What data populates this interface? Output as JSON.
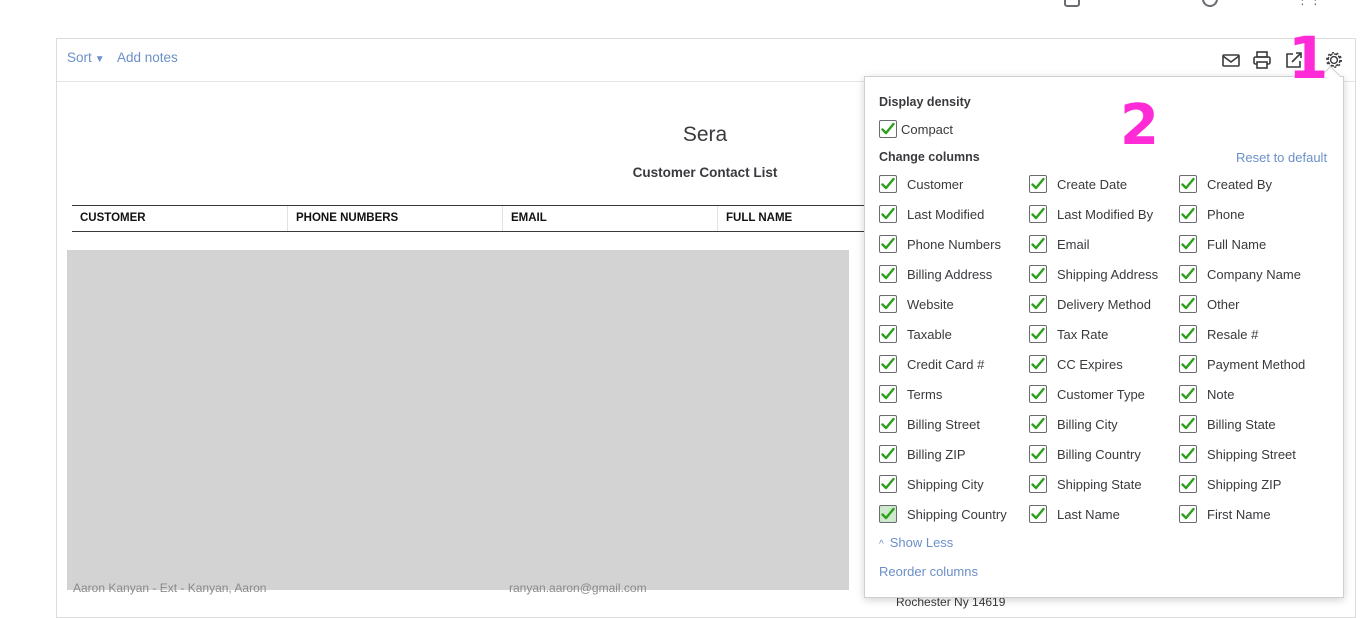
{
  "colors": {
    "link": "#6b90c8",
    "check": "#2ca01c",
    "annotation": "#ff2bd6"
  },
  "toolbar": {
    "sort_label": "Sort",
    "add_notes_label": "Add notes",
    "icons": [
      "email-icon",
      "print-icon",
      "export-icon",
      "gear-icon"
    ]
  },
  "report": {
    "company": "Sera",
    "title": "Customer Contact List",
    "columns": [
      "CUSTOMER",
      "PHONE NUMBERS",
      "EMAIL",
      "FULL NAME"
    ],
    "row_fragments": [
      "Aaron Kanyan - Ext - Kanyan, Aaron",
      "ranyan.aaron@gmail.com",
      "Rochester Ny 14619"
    ]
  },
  "panel": {
    "density_heading": "Display density",
    "compact_label": "Compact",
    "compact_checked": true,
    "columns_heading": "Change columns",
    "reset_label": "Reset to default",
    "options": [
      "Customer",
      "Create Date",
      "Created By",
      "Last Modified",
      "Last Modified By",
      "Phone",
      "Phone Numbers",
      "Email",
      "Full Name",
      "Billing Address",
      "Shipping Address",
      "Company Name",
      "Website",
      "Delivery Method",
      "Other",
      "Taxable",
      "Tax Rate",
      "Resale #",
      "Credit Card #",
      "CC Expires",
      "Payment Method",
      "Terms",
      "Customer Type",
      "Note",
      "Billing Street",
      "Billing City",
      "Billing State",
      "Billing ZIP",
      "Billing Country",
      "Shipping Street",
      "Shipping City",
      "Shipping State",
      "Shipping ZIP",
      "Shipping Country",
      "Last Name",
      "First Name"
    ],
    "all_checked": true,
    "show_less_label": "Show Less",
    "reorder_label": "Reorder columns"
  },
  "annotations": {
    "one": "1",
    "two": "2"
  }
}
